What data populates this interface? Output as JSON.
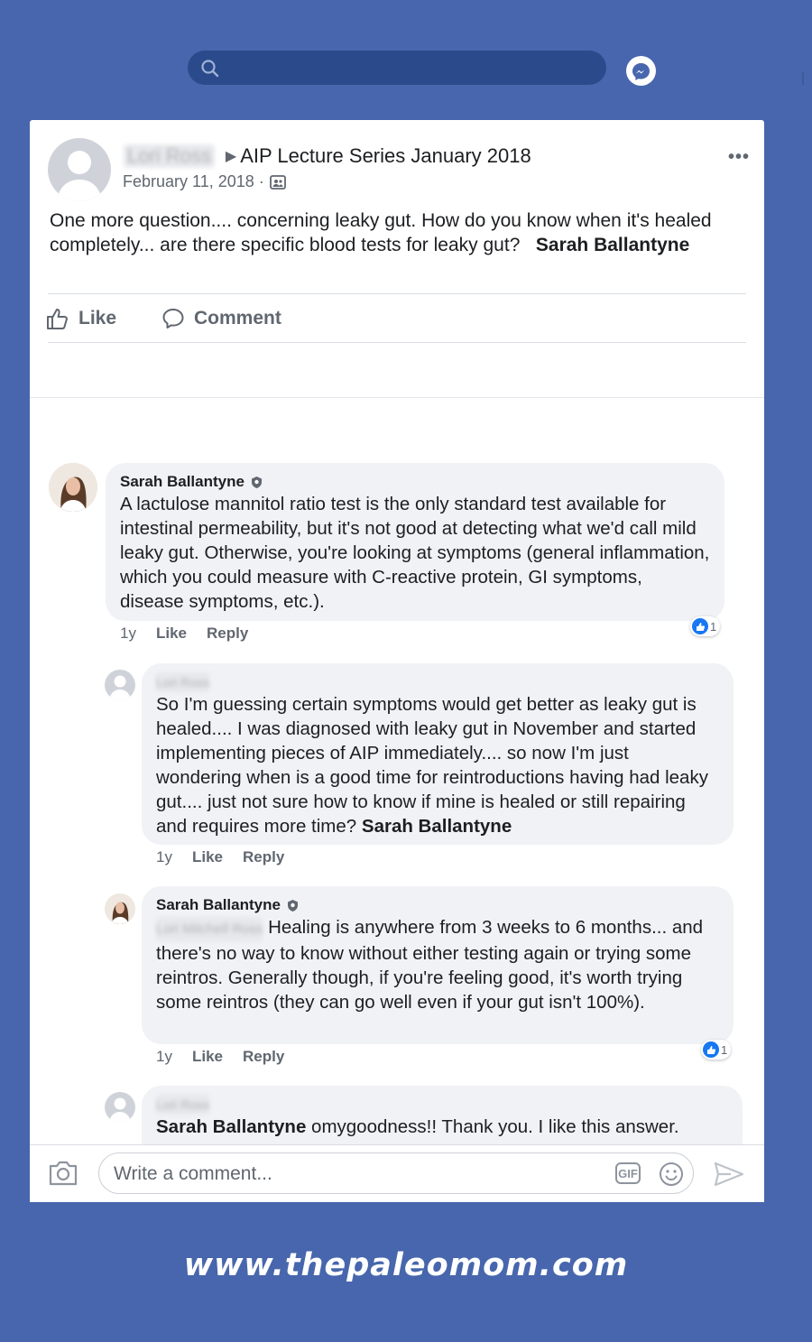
{
  "header": {
    "search_placeholder": "",
    "messenger_icon": "messenger-icon"
  },
  "post": {
    "author": "Lori Ross",
    "group": "AIP Lecture Series January 2018",
    "date": "February 11, 2018 ·",
    "text": "One more question.... concerning leaky gut.   How do you know when it's healed completely... are there specific blood tests for leaky gut?",
    "mention": "Sarah Ballantyne",
    "like_label": "Like",
    "comment_label": "Comment"
  },
  "comments": [
    {
      "author": "Sarah Ballantyne",
      "text": "A lactulose mannitol ratio test is the only standard test available for intestinal permeability, but it's not good at detecting what we'd call mild leaky gut.  Otherwise, you're looking at symptoms (general inflammation, which you could measure with C-reactive protein, GI symptoms, disease symptoms, etc.).",
      "time": "1y",
      "like": "Like",
      "reply": "Reply",
      "reactions": "1"
    },
    {
      "author": "Lori Ross",
      "text": "So I'm guessing certain symptoms would get better as leaky gut is healed.... I was diagnosed with leaky gut in November and started implementing pieces of AIP immediately.... so now I'm just wondering when is a good time for reintroductions having had leaky gut.... just not sure how to know if mine is healed or still repairing and requires more time?",
      "mention": "Sarah Ballantyne",
      "time": "1y",
      "like": "Like",
      "reply": "Reply"
    },
    {
      "author": "Sarah Ballantyne",
      "mention": "Lori Mitchell Ross",
      "text": "Healing is anywhere from 3 weeks to 6 months...  and there's no way to know without either testing again or trying some reintros.  Generally though, if you're feeling good, it's worth trying some reintros (they can go well even if your gut isn't 100%).",
      "time": "1y",
      "like": "Like",
      "reply": "Reply",
      "reactions": "1"
    },
    {
      "author": "Lori Ross",
      "mention": "Sarah Ballantyne",
      "text": "omygoodness!!   Thank you.   I like this answer."
    }
  ],
  "composer": {
    "placeholder": "Write a comment...",
    "gif_label": "GIF"
  },
  "footer": {
    "website": "www.thepaleomom.com"
  }
}
